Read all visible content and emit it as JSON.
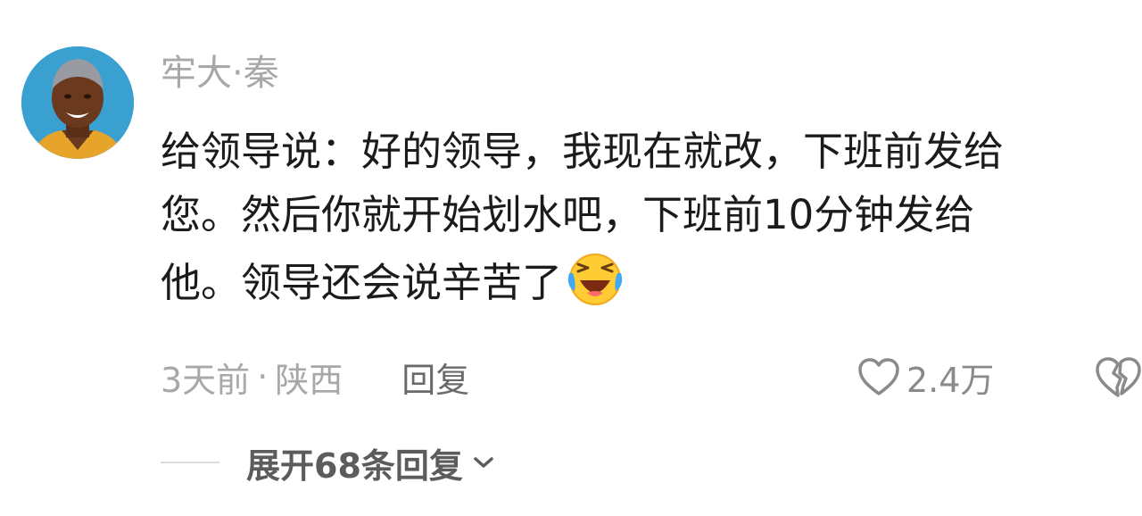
{
  "comment": {
    "author": "牢大·秦",
    "avatar_icon": "user-avatar",
    "text_lines": [
      "给领导说：好的领导，我现在就改，下班前发给",
      "您。然后你就开始划水吧，下班前10分钟发给",
      "他。领导还会说辛苦了"
    ],
    "emoji_icon": "laughing-crying-emoji",
    "time": "3天前",
    "separator": "·",
    "location": "陕西",
    "reply_label": "回复",
    "like_icon": "heart-outline-icon",
    "like_count": "2.4万",
    "dislike_icon": "broken-heart-icon",
    "expand_label": "展开68条回复",
    "expand_icon": "chevron-down-icon"
  },
  "colors": {
    "text_primary": "#1b1b1b",
    "text_secondary": "#a8a8a8",
    "avatar_bg": "#3aa0cf"
  }
}
